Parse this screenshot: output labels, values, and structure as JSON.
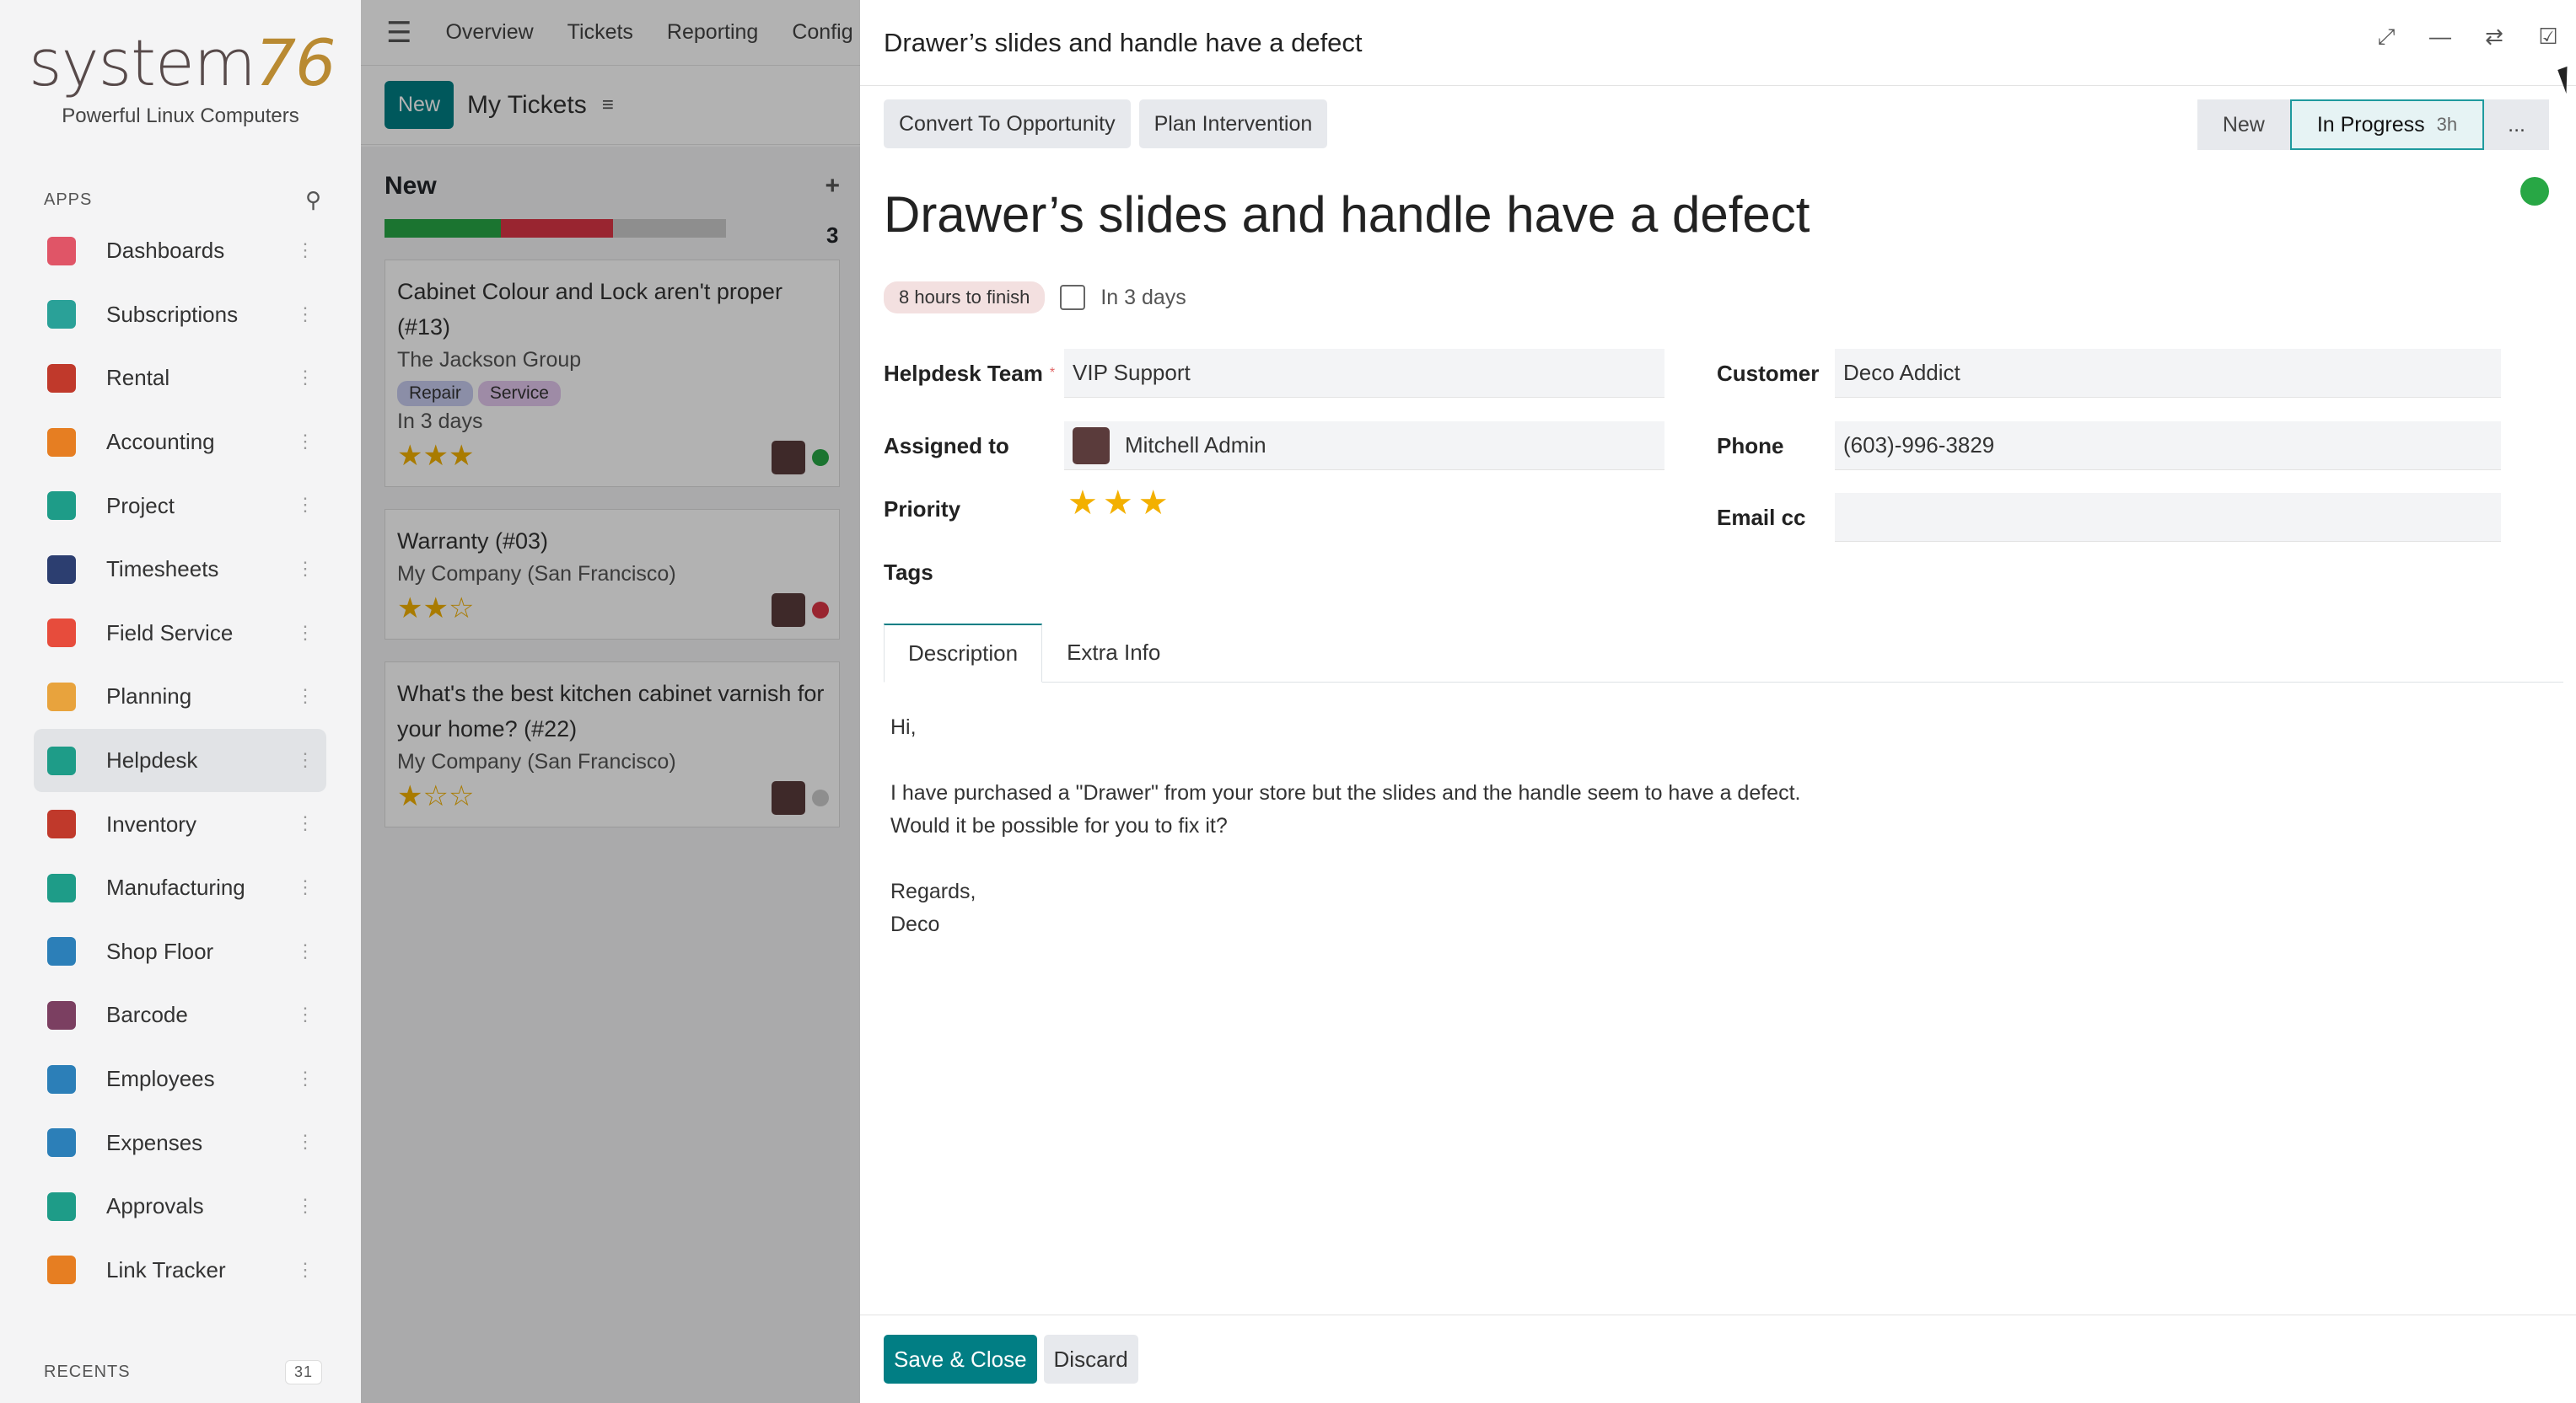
{
  "sidebar": {
    "brand": {
      "logo_text": "system",
      "logo_accent": "76",
      "tagline": "Powerful Linux Computers"
    },
    "apps_label": "APPS",
    "apps": [
      {
        "label": "Dashboards",
        "icon": "dashboards-icon",
        "color": "#e05567"
      },
      {
        "label": "Subscriptions",
        "icon": "subscriptions-icon",
        "color": "#2aa198"
      },
      {
        "label": "Rental",
        "icon": "rental-icon",
        "color": "#c0392b"
      },
      {
        "label": "Accounting",
        "icon": "accounting-icon",
        "color": "#e67e22"
      },
      {
        "label": "Project",
        "icon": "project-icon",
        "color": "#1e9c88"
      },
      {
        "label": "Timesheets",
        "icon": "timesheets-icon",
        "color": "#2c3e70"
      },
      {
        "label": "Field Service",
        "icon": "field-service-icon",
        "color": "#e74c3c"
      },
      {
        "label": "Planning",
        "icon": "planning-icon",
        "color": "#e8a33d"
      },
      {
        "label": "Helpdesk",
        "icon": "helpdesk-icon",
        "color": "#1e9c88"
      },
      {
        "label": "Inventory",
        "icon": "inventory-icon",
        "color": "#c0392b"
      },
      {
        "label": "Manufacturing",
        "icon": "manufacturing-icon",
        "color": "#1e9c88"
      },
      {
        "label": "Shop Floor",
        "icon": "shop-floor-icon",
        "color": "#2c7fb8"
      },
      {
        "label": "Barcode",
        "icon": "barcode-icon",
        "color": "#7b3f61"
      },
      {
        "label": "Employees",
        "icon": "employees-icon",
        "color": "#2c7fb8"
      },
      {
        "label": "Expenses",
        "icon": "expenses-icon",
        "color": "#2c7fb8"
      },
      {
        "label": "Approvals",
        "icon": "approvals-icon",
        "color": "#1e9c88"
      },
      {
        "label": "Link Tracker",
        "icon": "link-tracker-icon",
        "color": "#e67e22"
      }
    ],
    "active_app": "Helpdesk",
    "recents_label": "RECENTS",
    "recents_count": "31"
  },
  "background": {
    "nav": [
      "Overview",
      "Tickets",
      "Reporting",
      "Config"
    ],
    "new_button": "New",
    "breadcrumb": "My Tickets",
    "column": {
      "title": "New",
      "count": "3"
    },
    "cards": [
      {
        "title": "Cabinet Colour and Lock aren't proper (#13)",
        "company": "The Jackson Group",
        "tags": [
          "Repair",
          "Service"
        ],
        "deadline": "In 3 days",
        "stars": "★★★",
        "dot_color": "#28a745"
      },
      {
        "title": "Warranty (#03)",
        "company": "My Company (San Francisco)",
        "tags": [],
        "deadline": "",
        "stars": "★★☆",
        "dot_color": "#dc3545"
      },
      {
        "title": "What's the best kitchen cabinet varnish for your home? (#22)",
        "company": "My Company (San Francisco)",
        "tags": [],
        "deadline": "",
        "stars": "★☆☆",
        "dot_color": "#cccccc"
      }
    ]
  },
  "dialog": {
    "title": "Drawer’s slides and handle have a defect",
    "actions": {
      "convert": "Convert To Opportunity",
      "plan": "Plan Intervention"
    },
    "stages": {
      "new": "New",
      "current": "In Progress",
      "current_duration": "3h",
      "more": "..."
    },
    "status_color": "#28a745",
    "record_title": "Drawer’s slides and handle have a defect",
    "sla_badge": "8 hours to finish",
    "deadline_text": "In 3 days",
    "fields": {
      "team_label": "Helpdesk Team",
      "team_value": "VIP Support",
      "assigned_label": "Assigned to",
      "assigned_value": "Mitchell Admin",
      "priority_label": "Priority",
      "priority_stars": "★★★",
      "priority_level": 3,
      "tags_label": "Tags",
      "customer_label": "Customer",
      "customer_value": "Deco Addict",
      "phone_label": "Phone",
      "phone_value": "(603)-996-3829",
      "email_cc_label": "Email cc",
      "email_cc_value": ""
    },
    "tabs": [
      "Description",
      "Extra Info"
    ],
    "description": [
      "Hi,",
      "",
      "I have purchased a \"Drawer\" from your store but the slides and the handle seem to have a defect.",
      "Would it be possible for you to fix it?",
      "",
      "Regards,",
      "Deco"
    ],
    "footer": {
      "save": "Save & Close",
      "discard": "Discard"
    }
  }
}
